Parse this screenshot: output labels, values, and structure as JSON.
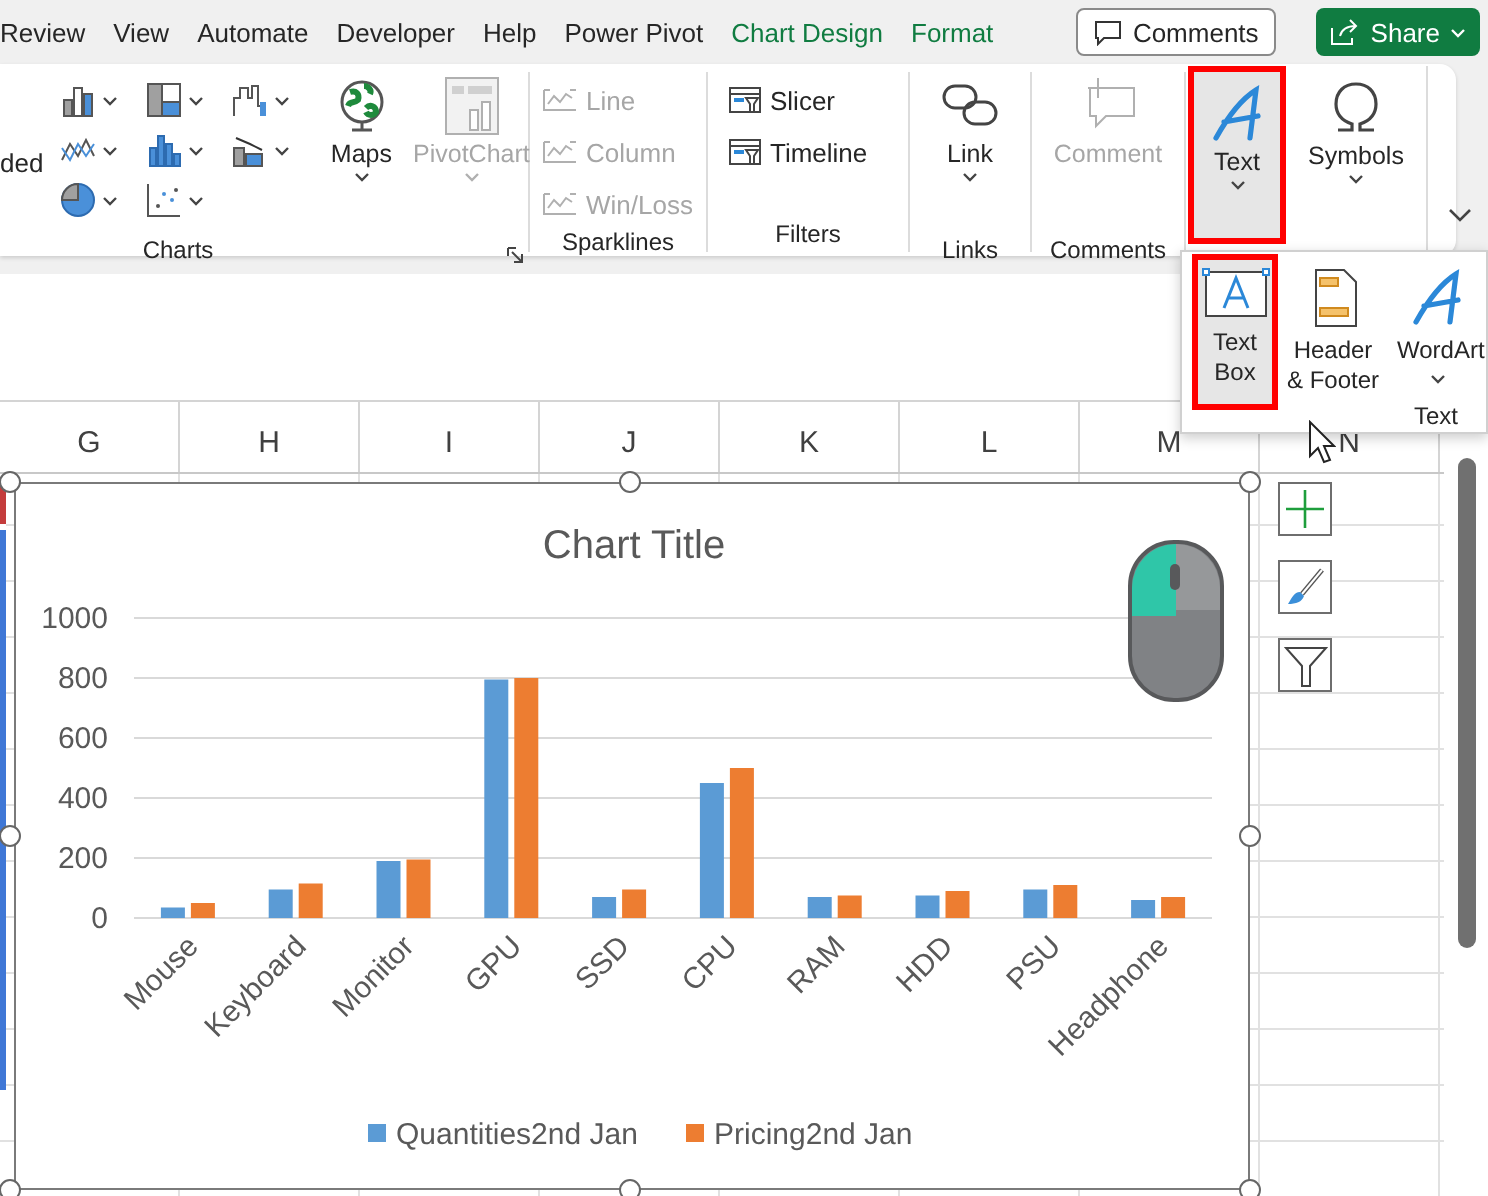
{
  "menu_tabs": [
    {
      "label": "Review",
      "kind": "standard"
    },
    {
      "label": "View",
      "kind": "standard"
    },
    {
      "label": "Automate",
      "kind": "standard"
    },
    {
      "label": "Developer",
      "kind": "standard"
    },
    {
      "label": "Help",
      "kind": "standard"
    },
    {
      "label": "Power Pivot",
      "kind": "standard"
    },
    {
      "label": "Chart Design",
      "kind": "contextual"
    },
    {
      "label": "Format",
      "kind": "contextual"
    }
  ],
  "comments_button": "Comments",
  "share_button": "Share",
  "ribbon": {
    "charts": {
      "label": "Charts",
      "cut_button": "ded",
      "maps": {
        "label": "Maps",
        "disabled": false
      },
      "pivotchart": {
        "label": "PivotChart",
        "disabled": true
      }
    },
    "sparklines": {
      "label": "Sparklines",
      "items": [
        {
          "label": "Line",
          "disabled": true
        },
        {
          "label": "Column",
          "disabled": true
        },
        {
          "label": "Win/Loss",
          "disabled": true
        }
      ]
    },
    "filters": {
      "label": "Filters",
      "items": [
        {
          "label": "Slicer",
          "disabled": false
        },
        {
          "label": "Timeline",
          "disabled": false
        }
      ]
    },
    "links": {
      "label": "Links",
      "button": {
        "label": "Link",
        "disabled": false
      }
    },
    "comments": {
      "label": "Comments",
      "button": {
        "label": "Comment",
        "disabled": true
      }
    },
    "text": {
      "label": "Text",
      "highlighted": true
    },
    "symbols": {
      "label": "Symbols"
    }
  },
  "text_dropdown": {
    "group_label": "Text",
    "items": [
      {
        "label": "Text Box",
        "kind": "textbox",
        "highlighted": true
      },
      {
        "label": "Header & Footer",
        "kind": "header",
        "highlighted": false
      },
      {
        "label": "WordArt",
        "kind": "wordart",
        "highlighted": false
      }
    ]
  },
  "columns": [
    "G",
    "H",
    "I",
    "J",
    "K",
    "L",
    "M",
    "N"
  ],
  "chart": {
    "chart_data": {
      "type": "bar",
      "title": "Chart Title",
      "categories": [
        "Mouse",
        "Keyboard",
        "Monitor",
        "GPU",
        "SSD",
        "CPU",
        "RAM",
        "HDD",
        "PSU",
        "Headphone"
      ],
      "series": [
        {
          "name": "Quantities2nd Jan",
          "color": "#5b9bd5",
          "values": [
            35,
            95,
            190,
            795,
            70,
            450,
            70,
            75,
            95,
            60
          ]
        },
        {
          "name": "Pricing2nd Jan",
          "color": "#ed7d31",
          "values": [
            50,
            115,
            195,
            800,
            95,
            500,
            75,
            90,
            110,
            70
          ]
        }
      ],
      "ylim": [
        0,
        1000
      ],
      "yticks": [
        0,
        200,
        400,
        600,
        800,
        1000
      ],
      "grid": true,
      "legend": true
    }
  }
}
